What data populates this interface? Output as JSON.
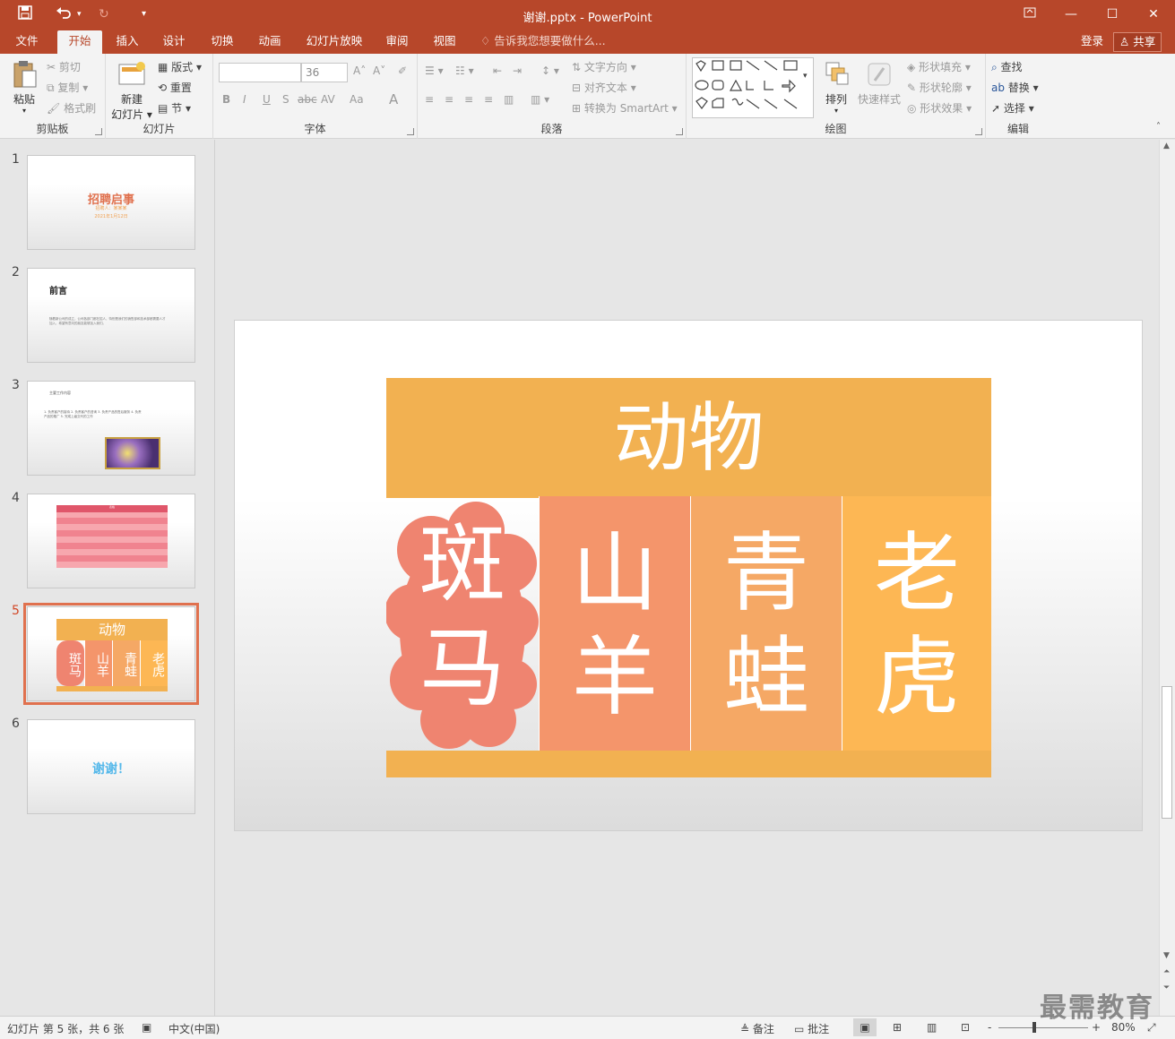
{
  "window": {
    "title": "谢谢.pptx - PowerPoint",
    "restore_icon": "ribbon-display-icon",
    "controls": [
      "minimize",
      "maximize",
      "close"
    ]
  },
  "tabs": [
    "文件",
    "开始",
    "插入",
    "设计",
    "切换",
    "动画",
    "幻灯片放映",
    "审阅",
    "视图"
  ],
  "active_tab": "开始",
  "tell_me": "告诉我您想要做什么...",
  "login": "登录",
  "share": "共享",
  "ribbon": {
    "clipboard": {
      "label": "剪贴板",
      "paste": "粘贴",
      "cut": "剪切",
      "copy": "复制",
      "format_painter": "格式刷"
    },
    "slides": {
      "label": "幻灯片",
      "new_slide_line1": "新建",
      "new_slide_line2": "幻灯片",
      "layout": "版式",
      "reset": "重置",
      "section": "节"
    },
    "font": {
      "label": "字体",
      "font_name": "",
      "font_size": "36",
      "bold": "B",
      "italic": "I",
      "underline": "U",
      "shadow": "S",
      "strike": "abc",
      "spacing": "AV",
      "case": "Aa",
      "color": "A"
    },
    "paragraph": {
      "label": "段落",
      "text_direction": "文字方向",
      "align_text": "对齐文本",
      "smartart": "转换为 SmartArt"
    },
    "drawing": {
      "label": "绘图",
      "arrange": "排列",
      "quick_styles": "快速样式",
      "shape_fill": "形状填充",
      "shape_outline": "形状轮廓",
      "shape_effects": "形状效果"
    },
    "editing": {
      "label": "编辑",
      "find": "查找",
      "replace": "替换",
      "select": "选择"
    }
  },
  "thumbnails": [
    {
      "num": "1",
      "title": "招聘启事",
      "subtitle": "招聘人：某某某",
      "date": "2021年1月12日"
    },
    {
      "num": "2",
      "title": "前言",
      "body": "随着新公司的成立，公司各部门都在招人，特别是我们的销售部和技术部都需要人才加入，希望有意向的朋友能够加入我们。"
    },
    {
      "num": "3",
      "title": "主要工作内容",
      "body": "1. 负责客户的接待 2. 负责客户的咨询 3. 负责产品的售后服务 4. 负责产品的推广 5. 完成上级交代的工作"
    },
    {
      "num": "4",
      "title": "表格"
    },
    {
      "num": "5",
      "title": "动物",
      "cells": [
        "斑马",
        "山羊",
        "青蛙",
        "老虎"
      ]
    },
    {
      "num": "6",
      "title": "谢谢！"
    }
  ],
  "active_slide": "5",
  "slide": {
    "title": "动物",
    "items": [
      {
        "line1": "斑",
        "line2": "马"
      },
      {
        "line1": "山",
        "line2": "羊"
      },
      {
        "line1": "青",
        "line2": "蛙"
      },
      {
        "line1": "老",
        "line2": "虎"
      }
    ],
    "colors": {
      "header": "#f2b151",
      "zebra": "#ef8470",
      "goat": "#f4956b",
      "frog": "#f5a865",
      "tiger": "#fdb754",
      "footer": "#f2b151"
    }
  },
  "status": {
    "slide_info": "幻灯片 第 5 张，共 6 张",
    "language": "中文(中国)",
    "notes": "备注",
    "comments": "批注",
    "zoom": "80%",
    "minus": "-",
    "plus": "+"
  },
  "watermark": "最需教育"
}
